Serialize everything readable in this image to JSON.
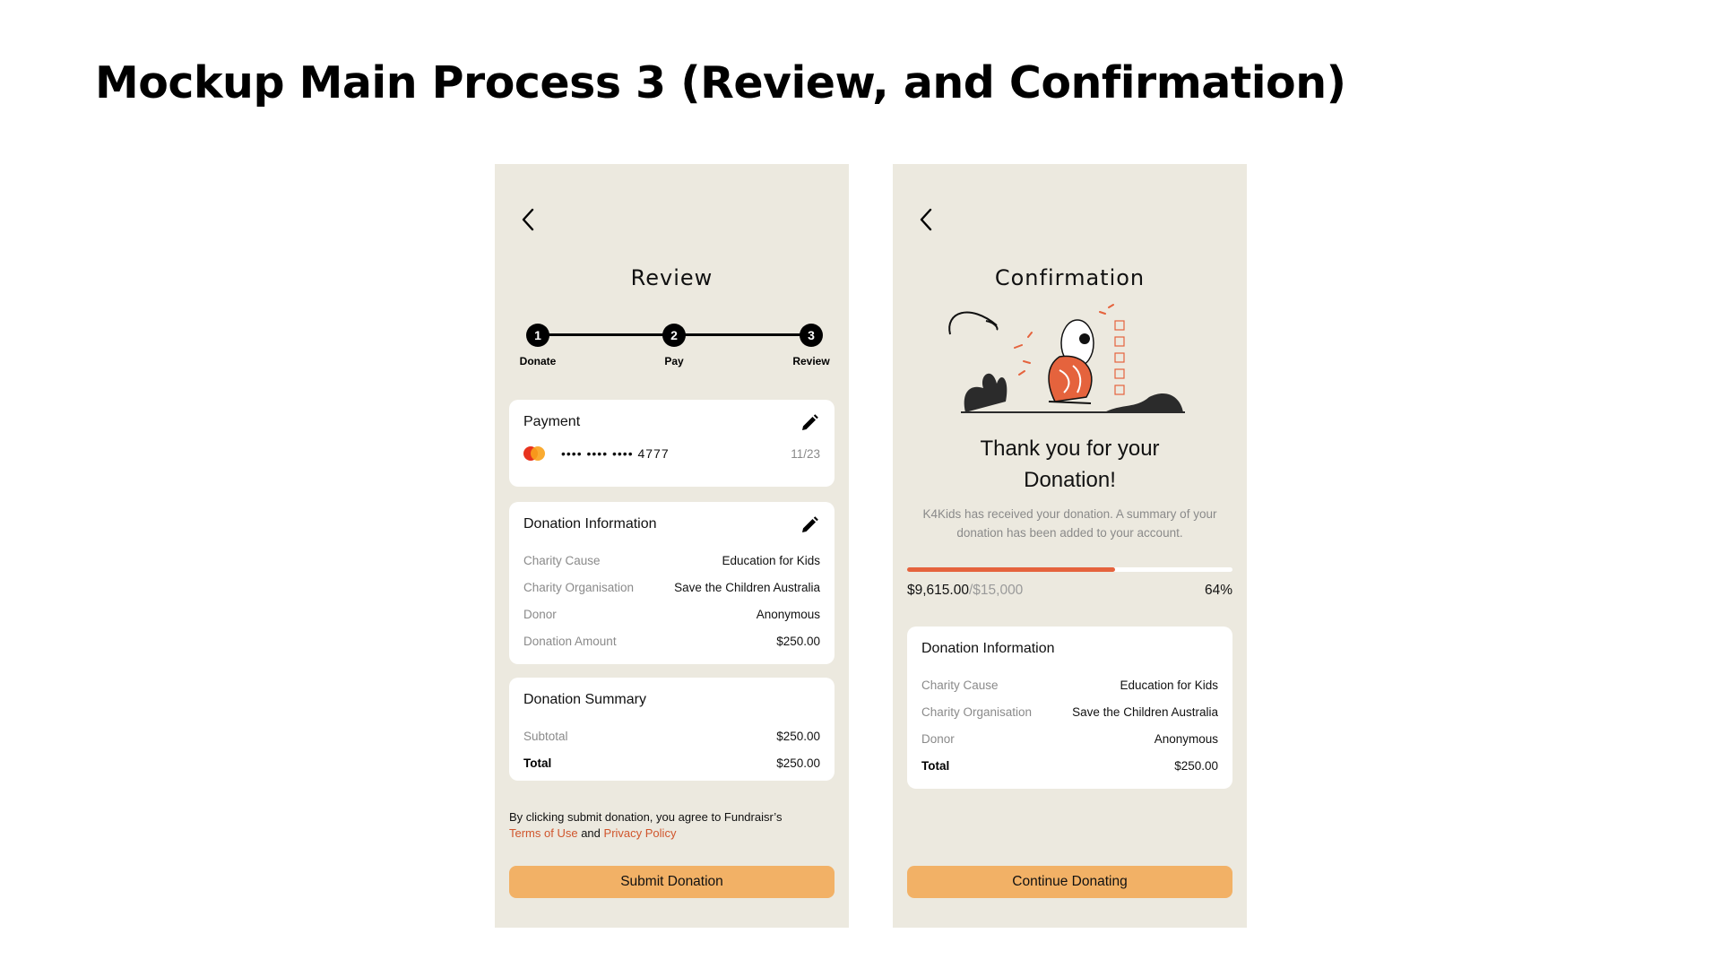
{
  "page_title": "Mockup Main Process 3 (Review, and Confirmation)",
  "review": {
    "title": "Review",
    "steps": [
      {
        "number": "1",
        "label": "Donate"
      },
      {
        "number": "2",
        "label": "Pay"
      },
      {
        "number": "3",
        "label": "Review"
      }
    ],
    "payment": {
      "title": "Payment",
      "card_number": "•••• •••• •••• 4777",
      "expiry": "11/23",
      "card_brand_icon": "mastercard-icon"
    },
    "donation_info": {
      "title": "Donation Information",
      "rows": [
        {
          "label": "Charity Cause",
          "value": "Education for Kids"
        },
        {
          "label": "Charity Organisation",
          "value": "Save the Children Australia"
        },
        {
          "label": "Donor",
          "value": "Anonymous"
        },
        {
          "label": "Donation Amount",
          "value": "$250.00"
        }
      ]
    },
    "summary": {
      "title": "Donation Summary",
      "rows": [
        {
          "label": "Subtotal",
          "value": "$250.00"
        },
        {
          "label": "Total",
          "value": "$250.00"
        }
      ]
    },
    "terms": {
      "prefix": "By clicking submit donation, you agree to Fundraisr’s",
      "terms_link": "Terms of Use",
      "and": "and",
      "privacy_link": "Privacy Policy"
    },
    "submit_label": "Submit Donation"
  },
  "confirmation": {
    "title": "Confirmation",
    "thanks_line1": "Thank you for your",
    "thanks_line2": "Donation!",
    "message": "K4Kids has received your donation. A summary of your donation has been added to your account.",
    "progress": {
      "raised": "$9,615.00",
      "goal": "/$15,000",
      "percent_label": "64%",
      "fraction": 0.64
    },
    "donation_info": {
      "title": "Donation Information",
      "rows": [
        {
          "label": "Charity Cause",
          "value": "Education for Kids"
        },
        {
          "label": "Charity Organisation",
          "value": "Save the Children Australia"
        },
        {
          "label": "Donor",
          "value": "Anonymous"
        },
        {
          "label": "Total",
          "value": "$250.00"
        }
      ]
    },
    "continue_label": "Continue Donating"
  },
  "colors": {
    "screen_bg": "#ECE9DF",
    "button": "#F2B166",
    "link": "#D0552C",
    "progress_fill": "#E5633D"
  }
}
